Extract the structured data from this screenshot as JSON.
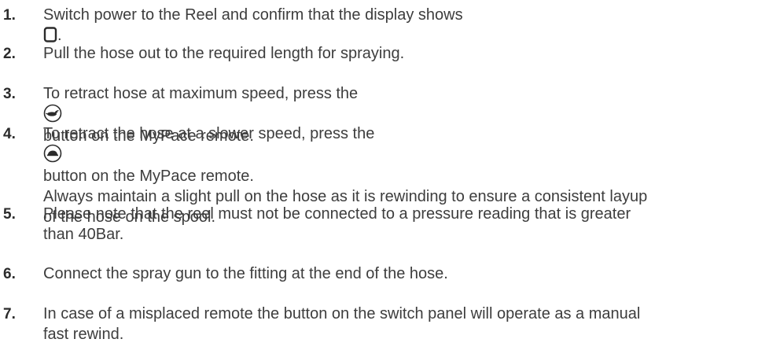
{
  "steps": [
    {
      "number": "1.",
      "before": "Switch power to the Reel and confirm that the display shows",
      "icon": "seven-segment-zero-icon",
      "after": "."
    },
    {
      "number": "2.",
      "text": "Pull the hose out to the required length for spraying."
    },
    {
      "number": "3.",
      "before": "To retract hose at maximum speed, press the",
      "icon": "hare-icon",
      "after": "button on the MyPace remote."
    },
    {
      "number": "4.",
      "before": "To retract the hose at a slower speed, press the",
      "icon": "tortoise-icon",
      "after": "button on the MyPace remote.",
      "continuation": "Always maintain a slight pull on the hose as it is rewinding to ensure a consistent layup\nof the hose on the spool."
    },
    {
      "number": "5.",
      "text": "Please note that the reel must not be connected to a pressure reading that is greater\nthan 40Bar."
    },
    {
      "number": "6.",
      "text": "Connect the spray gun to the fitting at the end of the hose."
    },
    {
      "number": "7.",
      "text": "In case of a misplaced remote the button on the switch panel will operate as a manual\nfast rewind."
    }
  ]
}
